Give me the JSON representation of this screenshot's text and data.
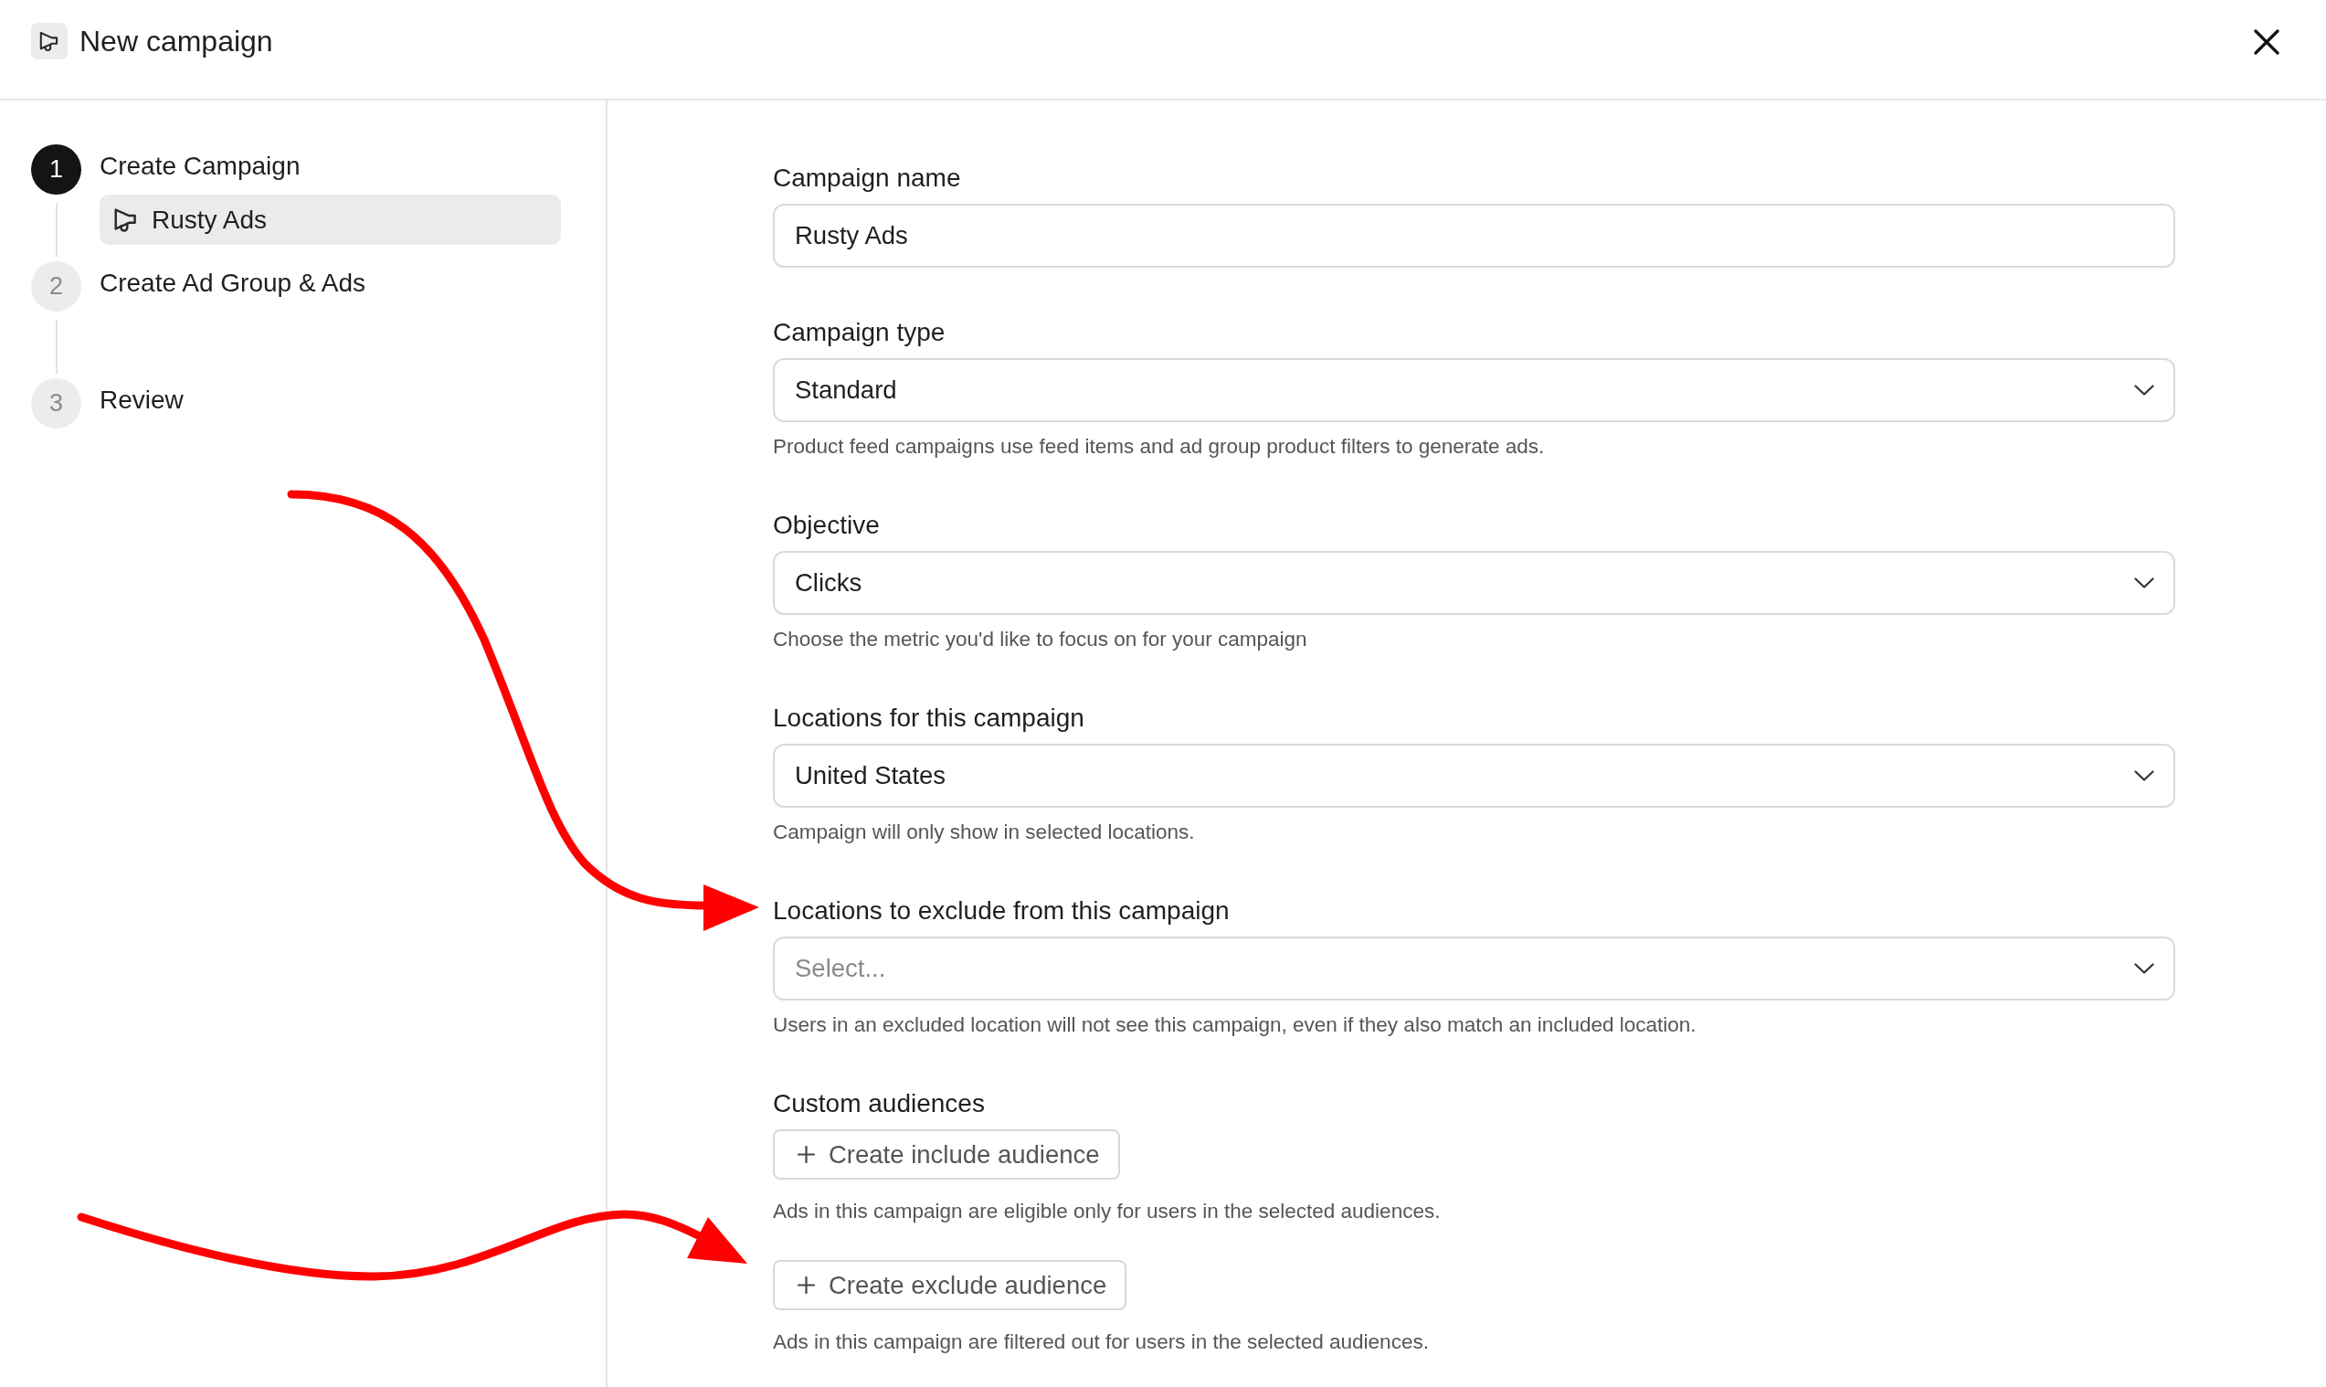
{
  "header": {
    "title": "New campaign"
  },
  "steps": [
    {
      "number": "1",
      "label": "Create Campaign",
      "selected": true,
      "children": [
        {
          "label": "Rusty Ads",
          "selected": true
        }
      ]
    },
    {
      "number": "2",
      "label": "Create Ad Group & Ads",
      "selected": false
    },
    {
      "number": "3",
      "label": "Review",
      "selected": false
    }
  ],
  "fields": [
    {
      "kind": "text",
      "label": "Campaign name",
      "value": "Rusty Ads"
    },
    {
      "kind": "select",
      "label": "Campaign type",
      "value": "Standard",
      "help": "Product feed campaigns use feed items and ad group product filters to generate ads."
    },
    {
      "kind": "select",
      "label": "Objective",
      "value": "Clicks",
      "help": "Choose the metric you'd like to focus on for your campaign"
    },
    {
      "kind": "select",
      "label": "Locations for this campaign",
      "value": "United States",
      "help": "Campaign will only show in selected locations."
    },
    {
      "kind": "select",
      "label": "Locations to exclude from this campaign",
      "placeholder": "Select...",
      "help": "Users in an excluded location will not see this campaign, even if they also match an included location."
    },
    {
      "kind": "buttons",
      "label": "Custom audiences",
      "buttons": [
        {
          "label": "Create include audience",
          "help": "Ads in this campaign are eligible only for users in the selected audiences."
        },
        {
          "label": "Create exclude audience",
          "help": "Ads in this campaign are filtered out for users in the selected audiences."
        }
      ]
    }
  ],
  "annotations": [
    {
      "kind": "arrow"
    },
    {
      "kind": "arrow"
    }
  ]
}
